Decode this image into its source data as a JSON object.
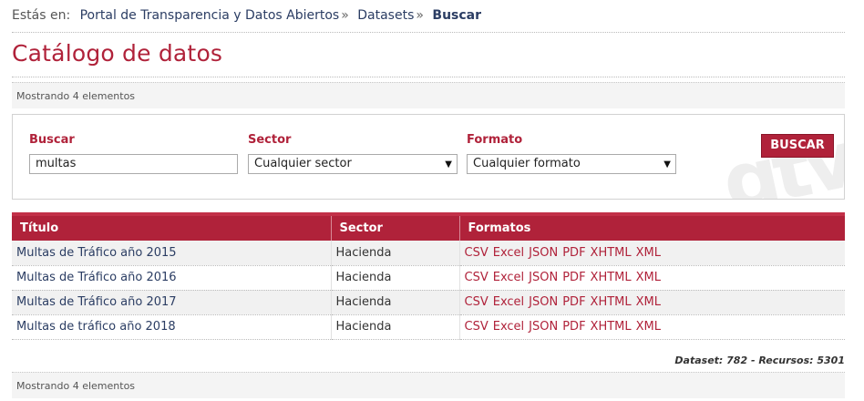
{
  "breadcrumb": {
    "prefix": "Estás en:",
    "items": [
      "Portal de Transparencia y Datos Abiertos",
      "Datasets"
    ],
    "separator": "»",
    "current": "Buscar"
  },
  "page_title": "Catálogo de datos",
  "count_text_top": "Mostrando 4 elementos",
  "count_text_bottom": "Mostrando 4 elementos",
  "search": {
    "buscar_label": "Buscar",
    "buscar_value": "multas",
    "sector_label": "Sector",
    "sector_selected": "Cualquier sector",
    "formato_label": "Formato",
    "formato_selected": "Cualquier formato",
    "button_label": "BUSCAR",
    "watermark": "gtv"
  },
  "table": {
    "headers": [
      "Título",
      "Sector",
      "Formatos"
    ],
    "rows": [
      {
        "title": "Multas de Tráfico año 2015",
        "sector": "Hacienda",
        "formats": [
          "CSV",
          "Excel",
          "JSON",
          "PDF",
          "XHTML",
          "XML"
        ]
      },
      {
        "title": "Multas de Tráfico año 2016",
        "sector": "Hacienda",
        "formats": [
          "CSV",
          "Excel",
          "JSON",
          "PDF",
          "XHTML",
          "XML"
        ]
      },
      {
        "title": "Multas de Tráfico año 2017",
        "sector": "Hacienda",
        "formats": [
          "CSV",
          "Excel",
          "JSON",
          "PDF",
          "XHTML",
          "XML"
        ]
      },
      {
        "title": "Multas de tráfico año 2018",
        "sector": "Hacienda",
        "formats": [
          "CSV",
          "Excel",
          "JSON",
          "PDF",
          "XHTML",
          "XML"
        ]
      }
    ]
  },
  "stats": "Dataset: 782 - Recursos: 5301",
  "colors": {
    "accent": "#b0223a",
    "link": "#2b3d63"
  }
}
